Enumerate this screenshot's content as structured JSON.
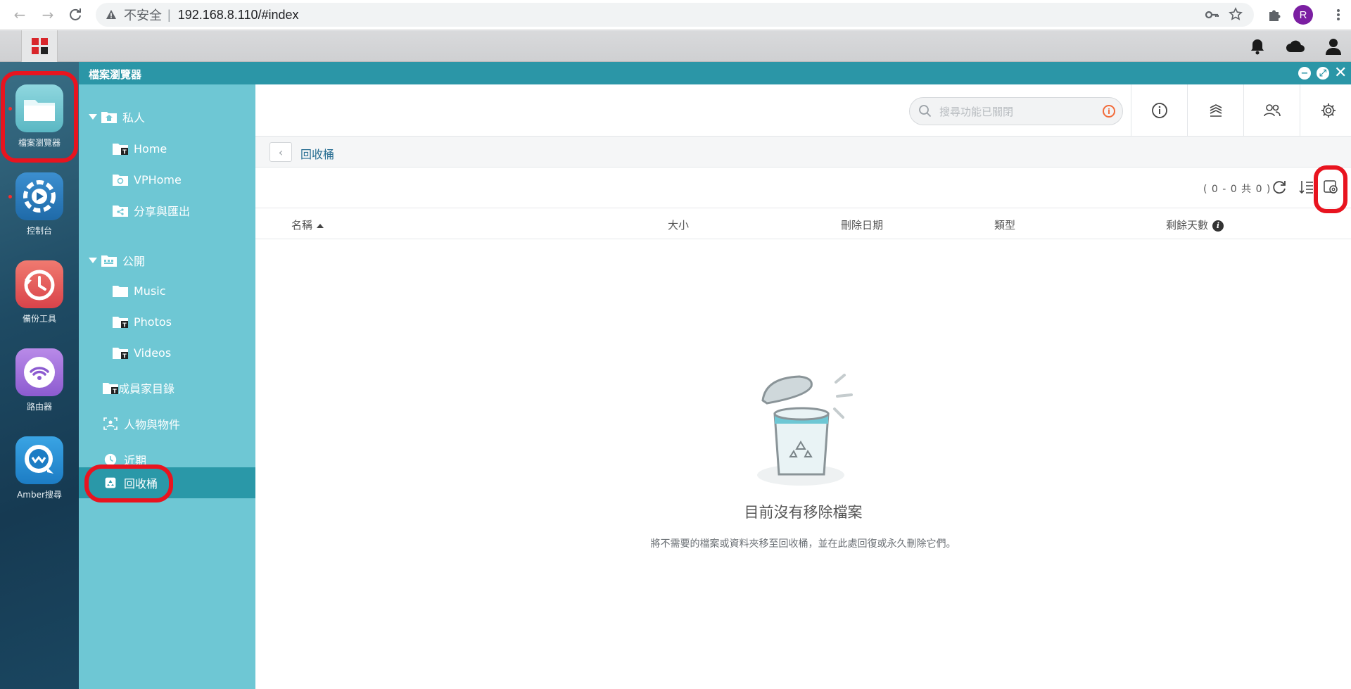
{
  "browser": {
    "security_label": "不安全",
    "separator": "|",
    "url": "192.168.8.110/#index",
    "profile_initial": "R"
  },
  "dock": {
    "apps": [
      {
        "label": "檔案瀏覽器",
        "icon": "folder-icon"
      },
      {
        "label": "控制台",
        "icon": "control-panel-icon"
      },
      {
        "label": "備份工具",
        "icon": "backup-clock-icon"
      },
      {
        "label": "路由器",
        "icon": "wifi-router-icon"
      },
      {
        "label": "Amber搜尋",
        "icon": "amber-search-icon"
      }
    ]
  },
  "window": {
    "title": "檔案瀏覽器"
  },
  "sidebar": {
    "private_group": "私人",
    "private_items": [
      "Home",
      "VPHome",
      "分享與匯出"
    ],
    "public_group": "公開",
    "public_items": [
      "Music",
      "Photos",
      "Videos"
    ],
    "family": "成員家目錄",
    "people": "人物與物件",
    "recent": "近期",
    "recycle": "回收桶"
  },
  "search": {
    "placeholder": "搜尋功能已關閉"
  },
  "breadcrumb": {
    "current": "回收桶"
  },
  "toolbar": {
    "count": "( 0 - 0 共 0 )"
  },
  "columns": {
    "name": "名稱",
    "size": "大小",
    "deleted_date": "刪除日期",
    "type": "類型",
    "remaining_days": "剩餘天數"
  },
  "empty": {
    "title": "目前沒有移除檔案",
    "subtitle": "將不需要的檔案或資料夾移至回收桶，並在此處回復或永久刪除它們。"
  },
  "colors": {
    "window_titlebar": "#2b96a7",
    "sidebar": "#6ec7d4",
    "sidebar_active": "#2a98a8",
    "highlight": "#e8141f"
  }
}
